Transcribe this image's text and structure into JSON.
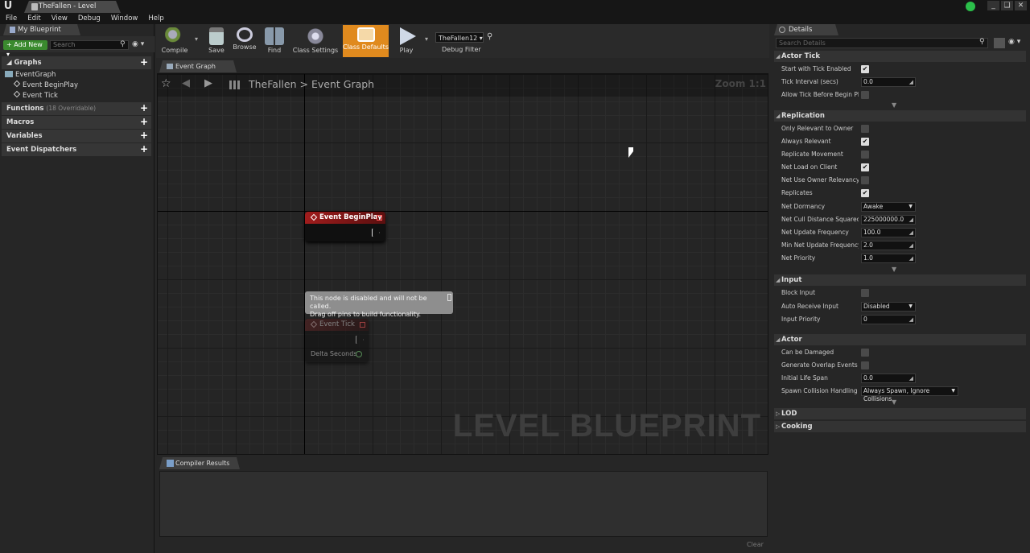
{
  "window": {
    "title": "TheFallen - Level Blueprint",
    "controls": [
      "_",
      "❑",
      "✕"
    ]
  },
  "menu": [
    "File",
    "Edit",
    "View",
    "Debug",
    "Window",
    "Help"
  ],
  "my_blueprint": {
    "tab": "My Blueprint",
    "add_new": "Add New",
    "search_placeholder": "Search",
    "graphs_label": "Graphs",
    "event_graph": "EventGraph",
    "events": [
      "Event BeginPlay",
      "Event Tick"
    ],
    "functions_label": "Functions",
    "functions_sub": "(18 Overridable)",
    "macros_label": "Macros",
    "variables_label": "Variables",
    "dispatchers_label": "Event Dispatchers"
  },
  "toolbar": {
    "compile": "Compile",
    "save": "Save",
    "browse": "Browse",
    "find": "Find",
    "class_settings": "Class Settings",
    "class_defaults": "Class Defaults",
    "play": "Play",
    "debug_select": "TheFallen12",
    "debug_filter": "Debug Filter"
  },
  "graph": {
    "tab": "Event Graph",
    "breadcrumb_root": "TheFallen",
    "breadcrumb_sep": ">",
    "breadcrumb_current": "Event Graph",
    "zoom": "Zoom 1:1",
    "watermark": "LEVEL BLUEPRINT",
    "node_begin": "Event BeginPlay",
    "node_tick": "Event Tick",
    "delta_seconds": "Delta Seconds",
    "tooltip_line1": "This node is disabled and will not be called.",
    "tooltip_line2": "Drag off pins to build functionality."
  },
  "compiler": {
    "tab": "Compiler Results",
    "clear": "Clear"
  },
  "details": {
    "tab": "Details",
    "search_placeholder": "Search Details",
    "actor_tick": {
      "label": "Actor Tick",
      "start_tick": "Start with Tick Enabled",
      "tick_interval": "Tick Interval (secs)",
      "tick_interval_val": "0.0",
      "allow_tick": "Allow Tick Before Begin Play"
    },
    "replication": {
      "label": "Replication",
      "only_relevant": "Only Relevant to Owner",
      "always_relevant": "Always Relevant",
      "replicate_movement": "Replicate Movement",
      "net_load": "Net Load on Client",
      "net_use_owner": "Net Use Owner Relevancy",
      "replicates": "Replicates",
      "net_dormancy": "Net Dormancy",
      "net_dormancy_val": "Awake",
      "net_cull": "Net Cull Distance Squared",
      "net_cull_val": "225000000.0",
      "net_update": "Net Update Frequency",
      "net_update_val": "100.0",
      "min_net_update": "Min Net Update Frequency",
      "min_net_update_val": "2.0",
      "net_priority": "Net Priority",
      "net_priority_val": "1.0"
    },
    "input": {
      "label": "Input",
      "block_input": "Block Input",
      "auto_receive": "Auto Receive Input",
      "auto_receive_val": "Disabled",
      "input_priority": "Input Priority",
      "input_priority_val": "0"
    },
    "actor": {
      "label": "Actor",
      "can_be_damaged": "Can be Damaged",
      "gen_overlap": "Generate Overlap Events During Level Streaming",
      "initial_life": "Initial Life Span",
      "initial_life_val": "0.0",
      "spawn_collision": "Spawn Collision Handling Method",
      "spawn_collision_val": "Always Spawn, Ignore Collisions"
    },
    "lod_label": "LOD",
    "cooking_label": "Cooking"
  },
  "colors": {
    "accent_orange": "#e08a1e",
    "event_red": "#8b1a1a",
    "add_green": "#3a8a2e"
  }
}
